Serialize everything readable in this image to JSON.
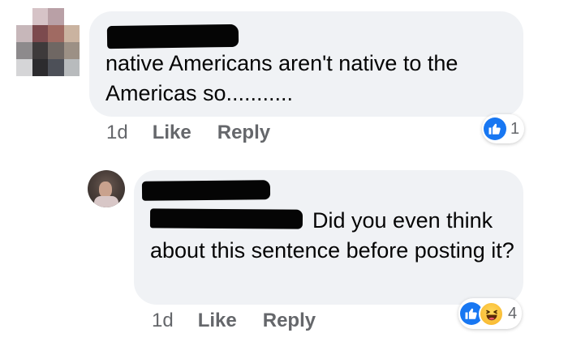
{
  "comments": [
    {
      "text": "native Americans aren't native to the Americas so...........",
      "time": "1d",
      "like_label": "Like",
      "reply_label": "Reply",
      "reaction_count": "1",
      "reactions": [
        "like-icon"
      ]
    },
    {
      "text": "Did you even think about this sentence before posting it?",
      "time": "1d",
      "like_label": "Like",
      "reply_label": "Reply",
      "reaction_count": "4",
      "reactions": [
        "like-icon",
        "haha-icon"
      ]
    }
  ],
  "colors": {
    "bubble": "#f0f2f5",
    "text": "#050505",
    "meta": "#65676b",
    "like_blue": "#1877f2",
    "haha_yellow": "#f7b125",
    "redaction": "#050505"
  }
}
